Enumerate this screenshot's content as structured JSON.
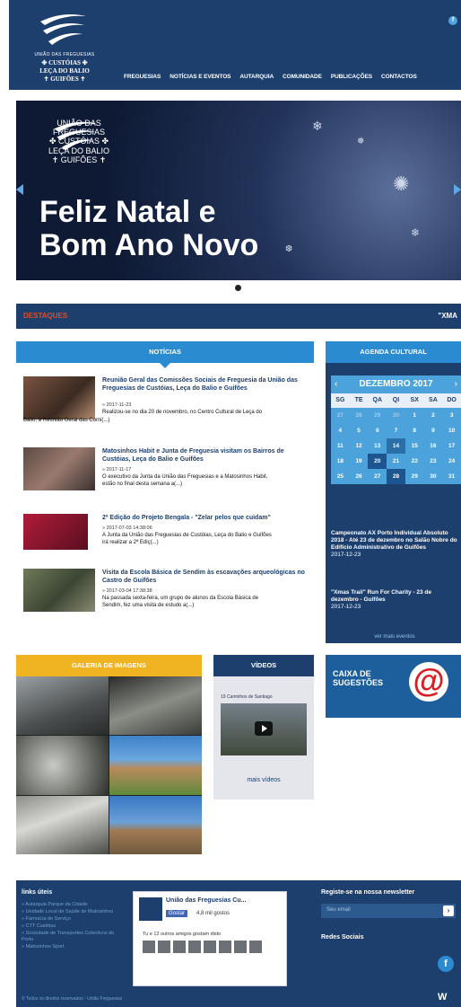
{
  "header": {
    "logo_lines": [
      "UNIÃO DAS FREGUESIAS",
      "✤ CUSTÓIAS ✤",
      "LEÇA DO BALIO",
      "✝ GUIFÕES ✝"
    ],
    "nav": [
      "FREGUESIAS",
      "NOTÍCIAS E EVENTOS",
      "AUTARQUIA",
      "COMUNIDADE",
      "PUBLICAÇÕES",
      "CONTACTOS"
    ],
    "facebook_glyph": "f"
  },
  "hero": {
    "logo_lines": [
      "UNIÃO DAS FREGUESIAS",
      "✤ CUSTÓIAS ✤",
      "LEÇA DO BALIO",
      "✝ GUIFÕES ✝"
    ],
    "title_line1": "Feliz Natal e",
    "title_line2": "Bom Ano Novo"
  },
  "destaques": {
    "label": "DESTAQUES",
    "ticker": "\"XMA"
  },
  "noticias": {
    "heading": "NOTÍCIAS",
    "items": [
      {
        "title": "Reunião Geral das Comissões Sociais de Freguesia da União das Freguesias de Custóias, Leça do Balio e Guifões",
        "date": "» 2017-11-23",
        "excerpt_first": "Realizou-se no dia 20 de novembro, no Centro Cultural de Leça do",
        "excerpt_rest": "Balio, a Reunião Geral das Comi(...)"
      },
      {
        "title": "Matosinhos Habit e Junta de Freguesia visitam os Bairros de Custóias, Leça do Balio e Guifões",
        "date": "» 2017-11-17",
        "excerpt_first": "O executivo da Junta da União das Freguesias e a Matosinhos Habit,",
        "excerpt_rest": "estão no final desta semana a(...)"
      },
      {
        "title": "2ª Edição do Projeto Bengala - \"Zelar pelos que cuidam\"",
        "date": "» 2017-07-03 14:38:06",
        "excerpt_first": "A Junta da União das Freguesias de Custóias, Leça do Balio e Guifões",
        "excerpt_rest": "irá realizar a 2ª Ediç(...)"
      },
      {
        "title": "Visita da Escola Básica de Sendim às escavações arqueológicas no Castro de Guifões",
        "date": "» 2017-03-04 17:38:38",
        "excerpt_first": "Na passada sexta-feira, um grupo de alunos da Escola Básica de",
        "excerpt_rest": "Sendim, fez uma visita de estudo a(...)"
      }
    ]
  },
  "agenda": {
    "heading": "AGENDA CULTURAL",
    "month": "DEZEMBRO 2017",
    "prev": "‹",
    "next": "›",
    "dow": [
      "SG",
      "TE",
      "QA",
      "QI",
      "SX",
      "SA",
      "DO"
    ],
    "days": [
      "27",
      "28",
      "29",
      "30",
      "1",
      "2",
      "3",
      "4",
      "5",
      "6",
      "7",
      "8",
      "9",
      "10",
      "11",
      "12",
      "13",
      "14",
      "15",
      "16",
      "17",
      "18",
      "19",
      "20",
      "21",
      "22",
      "23",
      "24",
      "25",
      "26",
      "27",
      "28",
      "29",
      "30",
      "31"
    ],
    "events": [
      {
        "text": "Campeonato AX Porto Individual Absoluto 2018 - Até 23 de dezembro no Salão Nobre do Edifício Administrativo de Guifões",
        "date": "2017-12-23"
      },
      {
        "text": "\"Xmas Trail\" Run For Charity - 23 de dezembro - Guifões",
        "date": "2017-12-23"
      }
    ],
    "more": "ver mais eventos"
  },
  "galeria": {
    "heading": "GALERIA DE IMAGENS"
  },
  "videos": {
    "heading": "VÍDEOS",
    "title": "19 Caminhos de Santiago",
    "more": "mais vídeos"
  },
  "caixa": {
    "line1": "CAIXA DE",
    "line2": "SUGESTÕES",
    "glyph": "@"
  },
  "footer": {
    "links_title": "links úteis",
    "links": [
      "» Autarquia Parque da Cidade",
      "» Unidade Local de Saúde de Matosinhos",
      "» Farmácia de Serviço",
      "» CTT Custóias",
      "» Sociedade de Transportes Colectivos do Porto",
      "» Matosinhos Sport"
    ],
    "fb_page": "União das Freguesias Cu...",
    "fb_like": "Gostar",
    "fb_likes": "4,8 mil gostos",
    "fb_friends": "Tu e 12 outros amigos gostam disto",
    "newsletter_title": "Registe-se na nossa newsletter",
    "newsletter_placeholder": "Seu email",
    "newsletter_go": "›",
    "redes": "Redes Sociais",
    "fb_glyph": "f",
    "copyright": "© Todos os direitos reservados - União Freguesias",
    "corner_logo": "W"
  }
}
